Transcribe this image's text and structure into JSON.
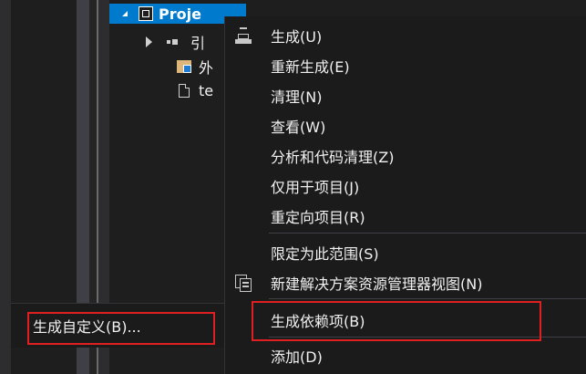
{
  "tree": {
    "project_label": "Proje",
    "references_label": "引",
    "external_label": "外",
    "file_label": "te"
  },
  "context_menu": {
    "items": [
      {
        "label": "生成(U)"
      },
      {
        "label": "重新生成(E)"
      },
      {
        "label": "清理(N)"
      },
      {
        "label": "查看(W)"
      },
      {
        "label": "分析和代码清理(Z)"
      },
      {
        "label": "仅用于项目(J)"
      },
      {
        "label": "重定向项目(R)"
      },
      {
        "label": "限定为此范围(S)"
      },
      {
        "label": "新建解决方案资源管理器视图(N)"
      },
      {
        "label": "生成依赖项(B)"
      },
      {
        "label": "添加(D)"
      }
    ]
  },
  "submenu": {
    "items": [
      {
        "label": "生成自定义(B)..."
      }
    ]
  },
  "colors": {
    "selection": "#007acc",
    "highlight_box": "#e02020",
    "menu_background": "#1b1b1c"
  }
}
